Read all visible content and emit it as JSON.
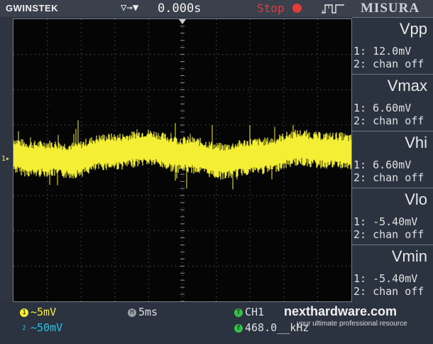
{
  "header": {
    "brand": "GWINSTEK",
    "trigger_symbol": "▽→▼",
    "time_offset": "0.000s",
    "run_state": "Stop",
    "label": "MISURA"
  },
  "colors": {
    "ch1": "#f4ef35",
    "ch2": "#25c4e8",
    "stop": "#e23b3b"
  },
  "measurements": [
    {
      "name": "Vpp",
      "ch1": "1: 12.0mV",
      "ch2": "2: chan off"
    },
    {
      "name": "Vmax",
      "ch1": "1: 6.60mV",
      "ch2": "2: chan off"
    },
    {
      "name": "Vhi",
      "ch1": "1: 6.60mV",
      "ch2": "2: chan off"
    },
    {
      "name": "Vlo",
      "ch1": "1: -5.40mV",
      "ch2": "2: chan off"
    },
    {
      "name": "Vmin",
      "ch1": "1: -5.40mV",
      "ch2": "2: chan off"
    }
  ],
  "status": {
    "ch1_badge": "1",
    "ch1_scale": "~5mV",
    "ch2_badge": "2",
    "ch2_scale": "~50mV",
    "timebase_badge": "M",
    "timebase": "5ms",
    "trigger_badge": "T",
    "trigger_source": "CH1",
    "freq_badge": "f",
    "frequency": "468.0__kHz"
  },
  "ground_marker": "1▸",
  "watermark": {
    "text": "nexthardware.com",
    "tagline": "your ultimate professional resource"
  }
}
